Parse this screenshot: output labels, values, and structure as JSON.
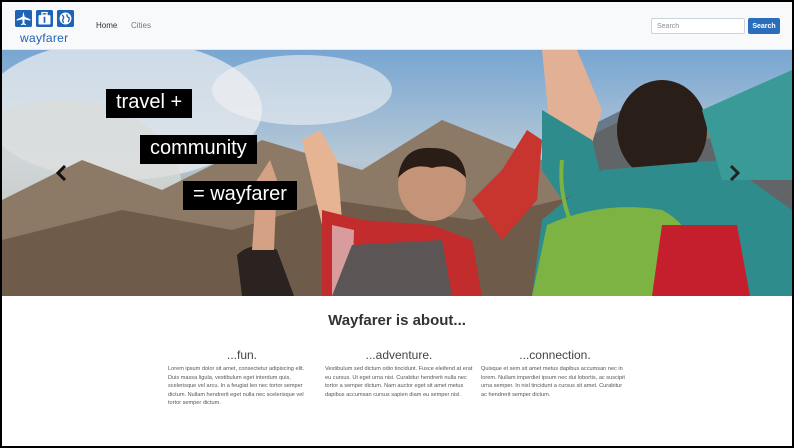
{
  "navbar": {
    "brand_name": "wayfarer",
    "brand_icons": [
      "airplane-icon",
      "suitcase-icon",
      "globe-icon"
    ],
    "links": [
      {
        "label": "Home",
        "active": true
      },
      {
        "label": "Cities",
        "active": false
      }
    ],
    "search": {
      "placeholder": "Search",
      "value": "",
      "button_label": "Search"
    }
  },
  "hero": {
    "taglines": [
      "travel +",
      "community",
      "=  wayfarer"
    ],
    "prev_icon": "chevron-left-icon",
    "next_icon": "chevron-right-icon"
  },
  "about": {
    "heading": "Wayfarer is about...",
    "columns": [
      {
        "title": "...fun.",
        "text": "Lorem ipsum dolor sit amet, consectetur adipiscing elit. Duis massa ligula, vestibulum eget interdum quis, scelerisque vel arcu. In a feugiat leo nec tortor semper dictum. Nullam hendrerit eget nulla nec scelerisque vel tortor semper dictum."
      },
      {
        "title": "...adventure.",
        "text": "Vestibulum sed dictum odio tincidunt. Fusce eleifend at erat eu cursus. Ut eget urna nisi. Curabitur hendrerit nulla nec tortor a semper dictum. Nam auctor eget sit amet metus dapibus accumsan cursus sapien diam eu semper nisl."
      },
      {
        "title": "...connection.",
        "text": "Quisque et sem sit amet metus dapibus accumsan nec in lorem. Nullam imperdiet ipsum nec dui lobortis, ac suscipit urna semper. In nisl tincidunt a cursus sit amet. Curabitur ac hendrerit semper dictum."
      }
    ]
  },
  "colors": {
    "brand_blue": "#1f63b5",
    "button_blue": "#2a6ebb",
    "navbar_bg": "#f8f9fa",
    "tag_bg": "#000000"
  }
}
